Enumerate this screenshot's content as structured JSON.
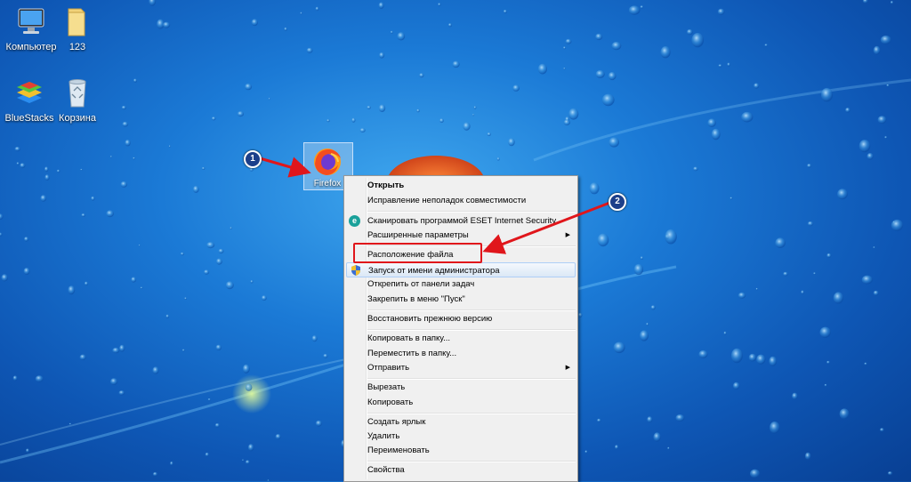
{
  "desktop": {
    "icons": [
      {
        "label": "Компьютер",
        "icon": "computer-icon"
      },
      {
        "label": "123",
        "icon": "folder-icon"
      },
      {
        "label": "BlueStacks",
        "icon": "bluestacks-icon"
      },
      {
        "label": "Корзина",
        "icon": "recycle-bin-icon"
      }
    ],
    "selected_icon": {
      "label": "Firefox",
      "icon": "firefox-icon"
    }
  },
  "annotations": {
    "badge1": "1",
    "badge2": "2",
    "arrow_color": "#e0161b"
  },
  "context_menu": {
    "items": [
      {
        "label": "Открыть"
      },
      {
        "label": "Исправление неполадок совместимости"
      },
      {
        "label": "Сканировать программой ESET Internet Security"
      },
      {
        "label": "Расширенные параметры"
      },
      {
        "label": "Расположение файла"
      },
      {
        "label": "Запуск от имени администратора"
      },
      {
        "label": "Открепить от панели задач"
      },
      {
        "label": "Закрепить в меню \"Пуск\""
      },
      {
        "label": "Восстановить прежнюю версию"
      },
      {
        "label": "Копировать в папку..."
      },
      {
        "label": "Переместить в папку..."
      },
      {
        "label": "Отправить"
      },
      {
        "label": "Вырезать"
      },
      {
        "label": "Копировать"
      },
      {
        "label": "Создать ярлык"
      },
      {
        "label": "Удалить"
      },
      {
        "label": "Переименовать"
      },
      {
        "label": "Свойства"
      }
    ]
  }
}
